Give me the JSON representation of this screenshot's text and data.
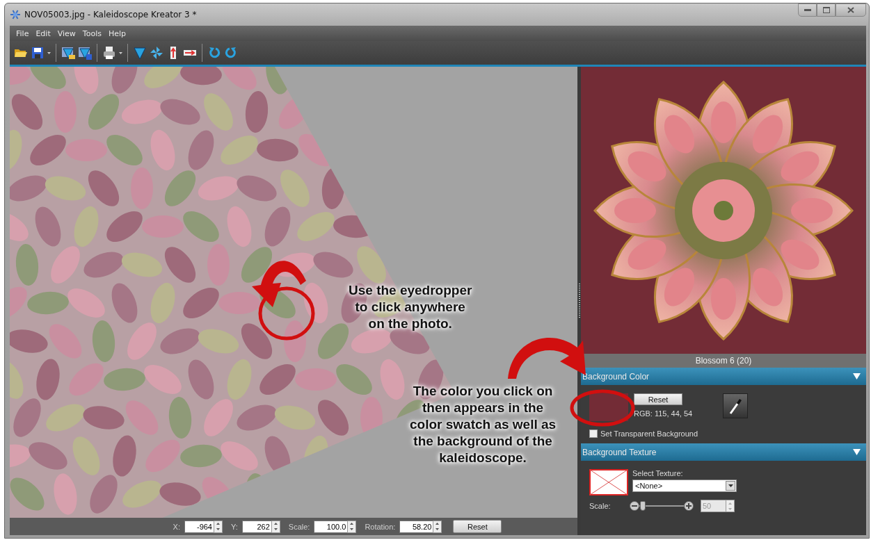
{
  "window": {
    "title": "NOV05003.jpg - Kaleidoscope Kreator 3 *"
  },
  "menu": [
    "File",
    "Edit",
    "View",
    "Tools",
    "Help"
  ],
  "annotations": [
    {
      "lines": [
        "Use the eyedropper",
        "to click anywhere",
        "on the photo."
      ]
    },
    {
      "lines": [
        "The color you click on",
        "then appears in the",
        "color swatch as well as",
        "the background of the",
        "kaleidoscope."
      ]
    }
  ],
  "preview": {
    "caption": "Blossom 6 (20)"
  },
  "sections": [
    {
      "kind": "color",
      "title": "Background Color",
      "expanded": true,
      "reset": "Reset",
      "rgb": "RGB: 115, 44, 54",
      "checkbox": {
        "label": "Set Transparent Background",
        "checked": false
      }
    },
    {
      "kind": "texture",
      "title": "Background Texture",
      "expanded": true,
      "select_label": "Select Texture:",
      "select_value": "<None>",
      "scale_label": "Scale:",
      "level": 0.08,
      "scale_value": "50"
    }
  ],
  "bottom_bar": {
    "fields": [
      {
        "label": "X:",
        "value": "-964"
      },
      {
        "label": "Y:",
        "value": "262"
      },
      {
        "label": "Scale:",
        "value": "100.0"
      },
      {
        "label": "Rotation:",
        "value": "58.20"
      }
    ],
    "reset": "Reset"
  }
}
